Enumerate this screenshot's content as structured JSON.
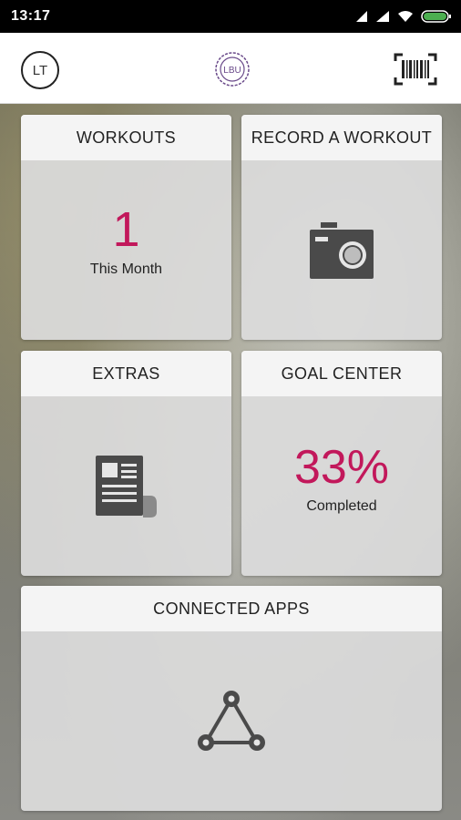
{
  "status_bar": {
    "time": "13:17",
    "icons": [
      "notification-arrow-icon",
      "signal-icon",
      "wifi-icon",
      "battery-icon"
    ]
  },
  "header": {
    "avatar_initials": "LT",
    "logo_text": "LBU",
    "barcode_icon": "barcode-icon"
  },
  "tiles": {
    "workouts": {
      "title": "WORKOUTS",
      "value": "1",
      "caption": "This Month"
    },
    "record": {
      "title": "RECORD A WORKOUT",
      "icon": "camera-icon"
    },
    "extras": {
      "title": "EXTRAS",
      "icon": "newspaper-icon"
    },
    "goal_center": {
      "title": "GOAL CENTER",
      "value": "33%",
      "caption": "Completed"
    },
    "connected_apps": {
      "title": "CONNECTED APPS",
      "icon": "connected-nodes-icon"
    }
  },
  "colors": {
    "accent": "#c2185b",
    "battery_fill": "#4caf50",
    "icon_gray": "#4a4a4a"
  }
}
